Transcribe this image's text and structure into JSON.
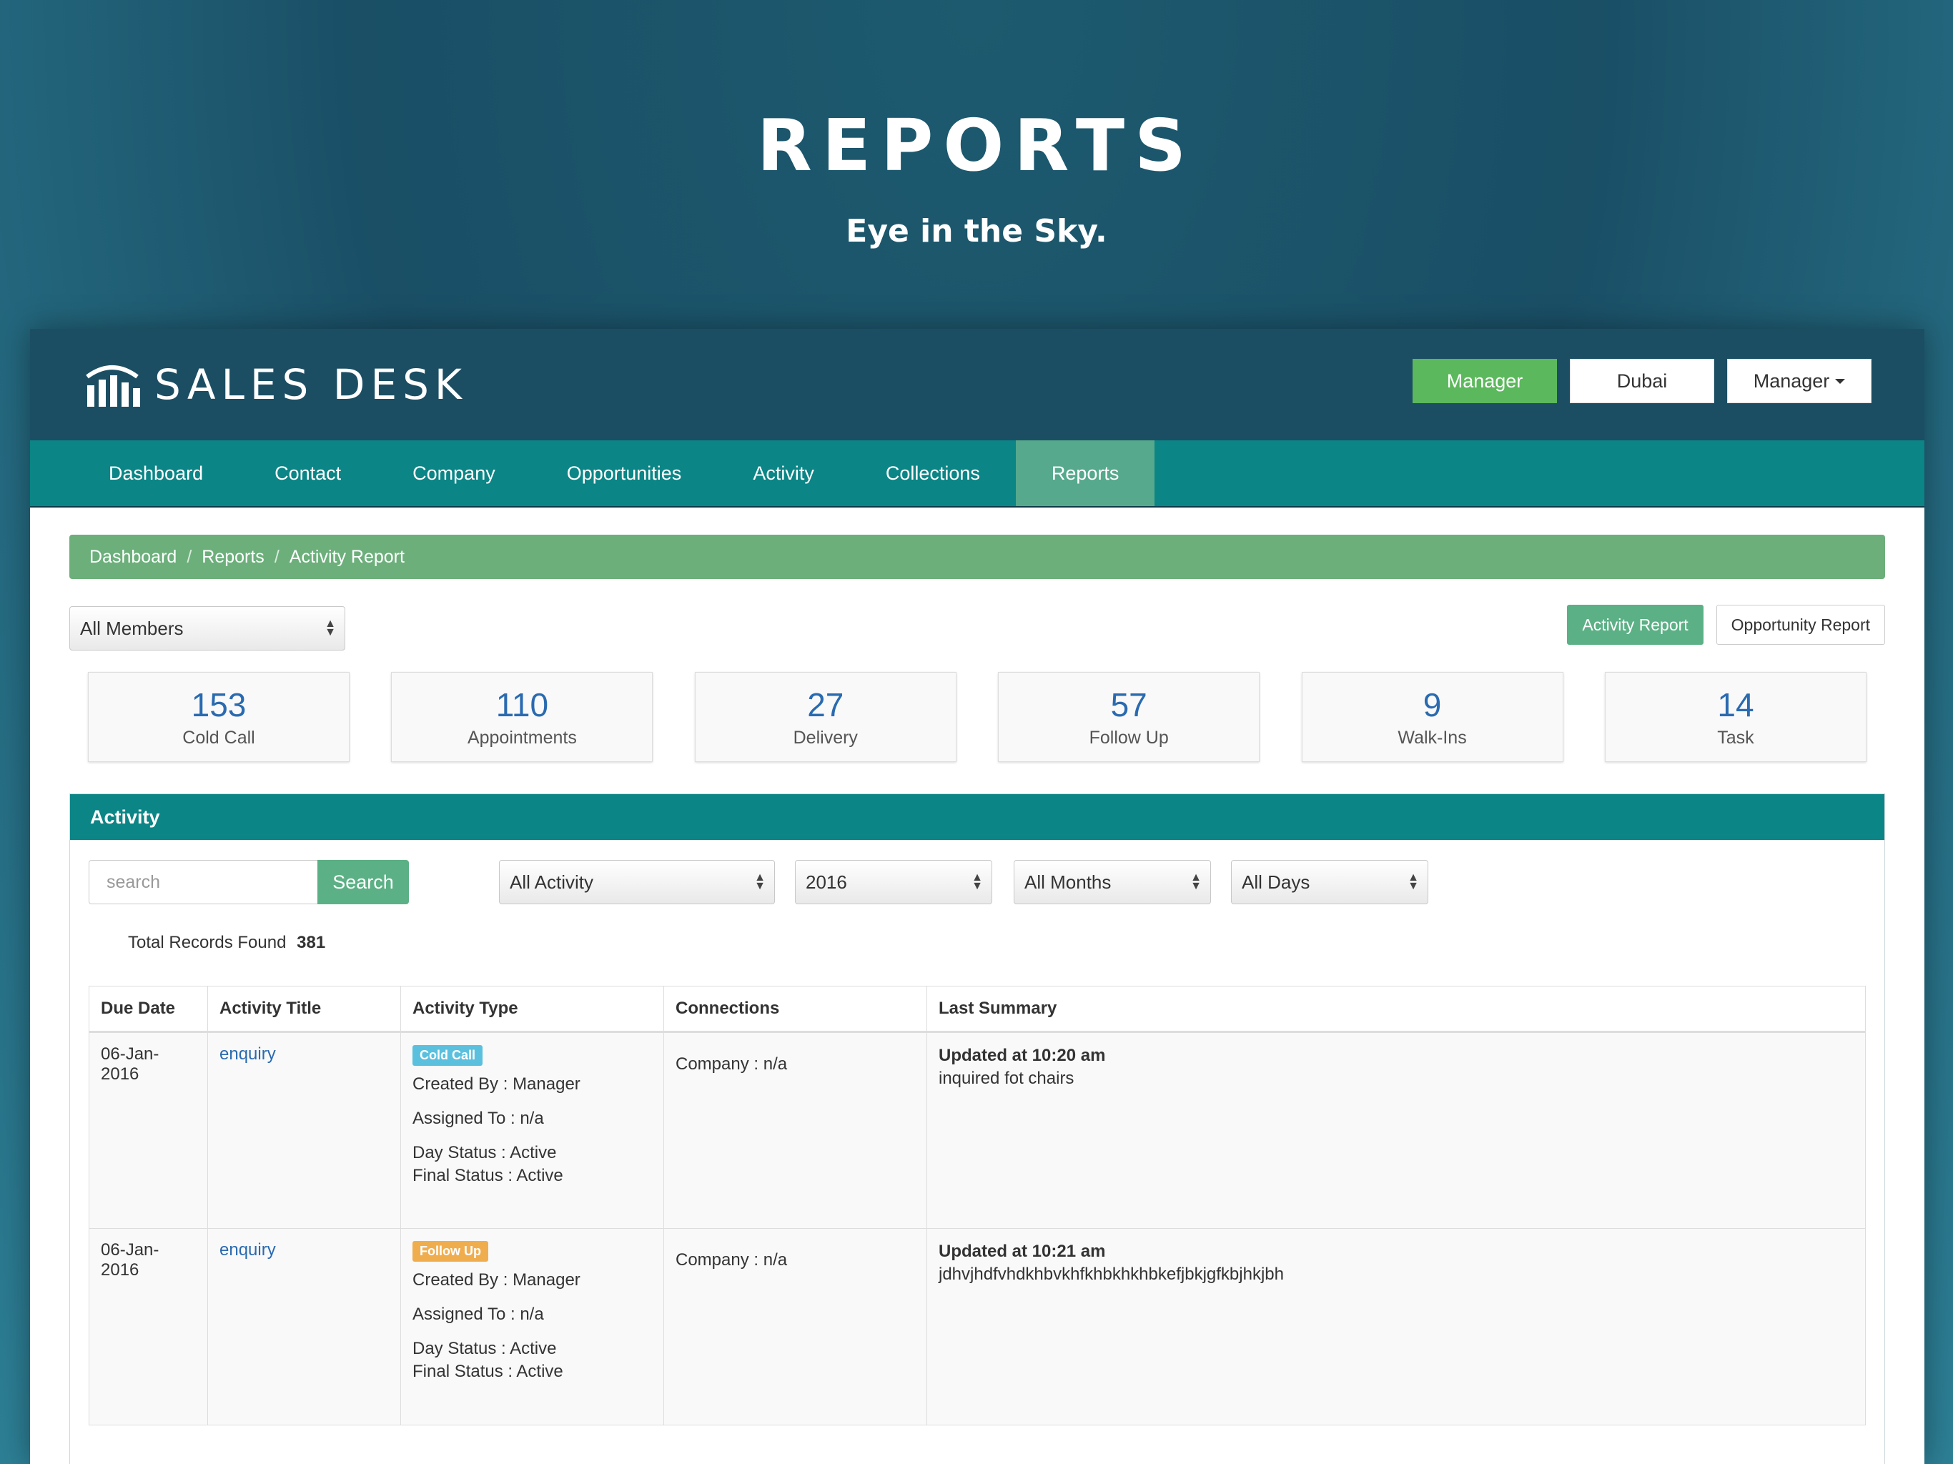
{
  "hero": {
    "title": "REPORTS",
    "subtitle": "Eye in the Sky."
  },
  "app": {
    "logo_text": "SALES DESK",
    "header_buttons": {
      "role": "Manager",
      "location": "Dubai",
      "user": "Manager"
    },
    "nav": [
      "Dashboard",
      "Contact",
      "Company",
      "Opportunities",
      "Activity",
      "Collections",
      "Reports"
    ],
    "nav_active": "Reports",
    "breadcrumb": [
      "Dashboard",
      "Reports",
      "Activity Report"
    ],
    "members_select": "All Members",
    "report_buttons": {
      "activity": "Activity Report",
      "opportunity": "Opportunity Report"
    },
    "stats": [
      {
        "value": "153",
        "label": "Cold Call"
      },
      {
        "value": "110",
        "label": "Appointments"
      },
      {
        "value": "27",
        "label": "Delivery"
      },
      {
        "value": "57",
        "label": "Follow Up"
      },
      {
        "value": "9",
        "label": "Walk-Ins"
      },
      {
        "value": "14",
        "label": "Task"
      }
    ],
    "panel_title": "Activity",
    "search": {
      "placeholder": "search",
      "button": "Search"
    },
    "filters": {
      "activity": "All Activity",
      "year": "2016",
      "months": "All Months",
      "days": "All Days"
    },
    "total": {
      "label": "Total Records Found",
      "value": "381"
    },
    "table": {
      "headers": [
        "Due Date",
        "Activity Title",
        "Activity Type",
        "Connections",
        "Last Summary"
      ],
      "rows": [
        {
          "due_date": "06-Jan-2016",
          "title": "enquiry",
          "type_badge": "Cold Call",
          "created_by": "Created By : Manager",
          "assigned_to": "Assigned To : n/a",
          "day_status": "Day Status : Active",
          "final_status": "Final Status : Active",
          "connections": "Company : n/a",
          "summary_time": "Updated at 10:20 am",
          "summary_text": "inquired fot chairs"
        },
        {
          "due_date": "06-Jan-2016",
          "title": "enquiry",
          "type_badge": "Follow Up",
          "created_by": "Created By : Manager",
          "assigned_to": "Assigned To : n/a",
          "day_status": "Day Status : Active",
          "final_status": "Final Status : Active",
          "connections": "Company : n/a",
          "summary_time": "Updated at 10:21 am",
          "summary_text": "jdhvjhdfvhdkhbvkhfkhbkhkhbkefjbkjgfkbjhkjbh"
        }
      ]
    },
    "colors": {
      "topbar": "#1c4e63",
      "nav": "#0b8586",
      "nav_active": "#56a98c",
      "breadcrumb": "#6caf7b",
      "green_button": "#5cb85c",
      "stat_number": "#2a6ab0",
      "badge_cold_call": "#5bc0de",
      "badge_follow_up": "#f0ad4e"
    }
  }
}
